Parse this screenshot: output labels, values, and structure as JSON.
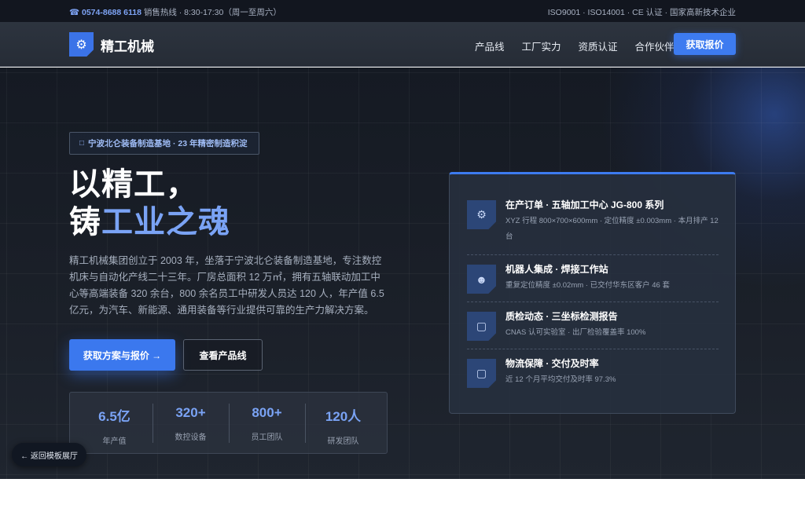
{
  "topbar": {
    "phone": "☎ 0574-8688 6118",
    "hotline": " 销售热线 · 8:30-17:30（周一至周六）",
    "certs": "ISO9001 · ISO14001 · CE 认证 · 国家高新技术企业"
  },
  "nav": {
    "logo_icon": "gear-icon",
    "logo_glyph": "⚙",
    "brand": "精工机械",
    "items": [
      "产品线",
      "工厂实力",
      "资质认证",
      "合作伙伴"
    ],
    "cta": "获取报价"
  },
  "hero": {
    "badge_icon": "□",
    "badge": "宁波北仑装备制造基地 · 23 年精密制造积淀",
    "headline_line1": "以精工，",
    "headline_line2_plain": "铸",
    "headline_line2_accent": "工业之魂",
    "description": "精工机械集团创立于 2003 年，坐落于宁波北仑装备制造基地，专注数控机床与自动化产线二十三年。厂房总面积 12 万㎡，拥有五轴联动加工中心等高端装备 320 余台，800 余名员工中研发人员达 120 人，年产值 6.5 亿元，为汽车、新能源、通用装备等行业提供可靠的生产力解决方案。",
    "primary_button": "获取方案与报价 →",
    "secondary_button": "查看产品线",
    "stats": [
      {
        "value": "6.5亿",
        "label": "年产值"
      },
      {
        "value": "320+",
        "label": "数控设备"
      },
      {
        "value": "800+",
        "label": "员工团队"
      },
      {
        "value": "120人",
        "label": "研发团队"
      }
    ]
  },
  "status_card": {
    "items": [
      {
        "icon": "gear-icon",
        "glyph": "⚙",
        "title": "在产订单 · 五轴加工中心 JG-800 系列",
        "subtitle": "XYZ 行程 800×700×600mm · 定位精度 ±0.003mm · 本月排产 12 台"
      },
      {
        "icon": "robot-icon",
        "glyph": "☻",
        "title": "机器人集成 · 焊接工作站",
        "subtitle": "重复定位精度 ±0.02mm · 已交付华东区客户 46 套"
      },
      {
        "icon": "inspection-icon",
        "glyph": "▢",
        "title": "质检动态 · 三坐标检测报告",
        "subtitle": "CNAS 认可实验室 · 出厂检验覆盖率 100%"
      },
      {
        "icon": "logistics-icon",
        "glyph": "▢",
        "title": "物流保障 · 交付及时率",
        "subtitle": "近 12 个月平均交付及时率 97.3%"
      }
    ]
  },
  "back_button": "← 返回模板展厅",
  "colors": {
    "accent": "#3d7bf0",
    "accent_text": "#7aa3f5",
    "dark_bg": "#1b2029"
  }
}
